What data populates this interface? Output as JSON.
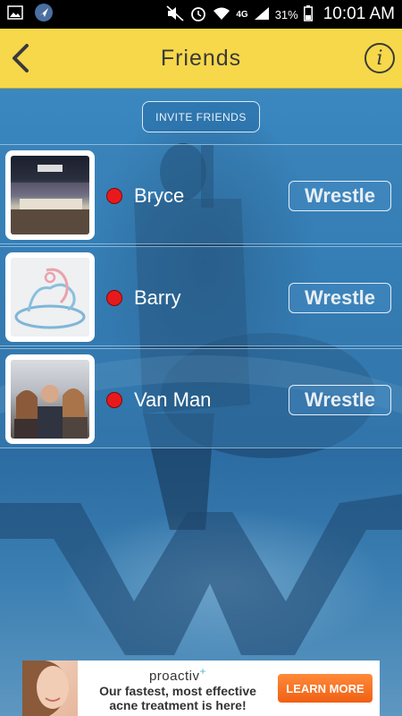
{
  "status_bar": {
    "network": "4G",
    "battery": "31%",
    "time": "10:01 AM"
  },
  "header": {
    "title": "Friends"
  },
  "invite_label": "INVITE FRIENDS",
  "friends": [
    {
      "name": "Bryce",
      "status_color": "#e8191c",
      "action_label": "Wrestle"
    },
    {
      "name": "Barry",
      "status_color": "#e8191c",
      "action_label": "Wrestle"
    },
    {
      "name": "Van Man",
      "status_color": "#e8191c",
      "action_label": "Wrestle"
    }
  ],
  "ad": {
    "brand": "proactiv",
    "brand_mark": "+",
    "line1": "Our fastest, most effective",
    "line2": "acne treatment is here!",
    "cta": "LEARN MORE"
  },
  "colors": {
    "header_bg": "#f6d84a",
    "status_dot": "#e8191c",
    "cta_orange": "#f06014"
  }
}
